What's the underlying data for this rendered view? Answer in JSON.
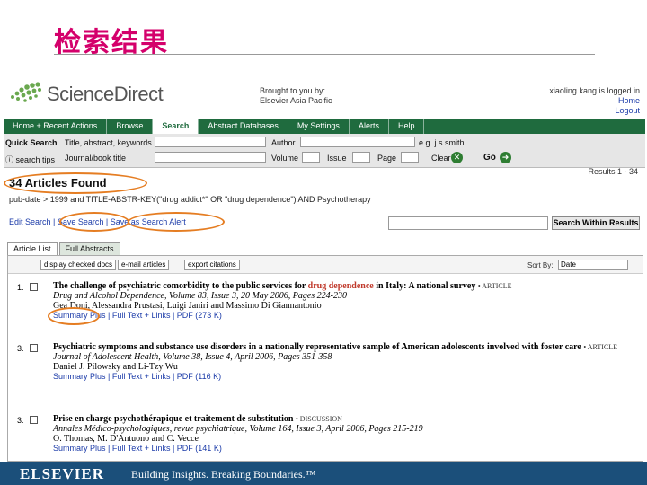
{
  "slide": {
    "title": "检索结果"
  },
  "header": {
    "logo_text": "ScienceDirect",
    "brought_to_you_by": "Brought to you by:",
    "institution": "Elsevier Asia Pacific",
    "user": "xiaoling kang is logged in",
    "home_link": "Home",
    "logout_link": "Logout"
  },
  "nav": {
    "items": [
      {
        "label": "Home + Recent Actions"
      },
      {
        "label": "Browse"
      },
      {
        "label": "Search"
      },
      {
        "label": "Abstract Databases"
      },
      {
        "label": "My Settings"
      },
      {
        "label": "Alerts"
      },
      {
        "label": "Help"
      }
    ]
  },
  "quick_search": {
    "label": "Quick Search",
    "field1_label": "Title, abstract, keywords",
    "author_label": "Author",
    "author_value": "e.g. j s smith",
    "search_tips": "search tips",
    "journal_label": "Journal/book title",
    "volume_label": "Volume",
    "issue_label": "Issue",
    "page_label": "Page",
    "clear_label": "Clear",
    "go_label": "Go"
  },
  "results": {
    "found_text": "34 Articles Found",
    "range_text": "Results 1 - 34",
    "query_text": "pub-date > 1999 and TITLE-ABSTR-KEY(\"drug addict*\" OR \"drug dependence\") AND Psychotherapy",
    "edit_search": "Edit Search",
    "save_search": "Save Search",
    "save_alert": "Save as Search Alert",
    "search_within_button": "Search Within Results",
    "tabs": [
      {
        "label": "Article List"
      },
      {
        "label": "Full Abstracts"
      }
    ],
    "toolbar": {
      "display_checked": "display checked docs",
      "email_articles": "e-mail articles",
      "export_citations": "export citations",
      "sort_label": "Sort By:",
      "sort_value": "Date"
    },
    "items": [
      {
        "num": "1.",
        "title_pre": "The challenge of psychiatric comorbidity to the public services for ",
        "title_hl": "drug dependence",
        "title_post": " in Italy: A national survey",
        "type": "• ARTICLE",
        "journal": "Drug and Alcohol Dependence, Volume 83, Issue 3, 20 May 2006, Pages 224-230",
        "authors": "Gea Doni, Alessandra Prustasi, Luigi Janiri and Massimo Di Giannantonio",
        "links": "Summary Plus | Full Text + Links | PDF (273 K)"
      },
      {
        "num": "3.",
        "title_pre": "Psychiatric symptoms and substance use disorders in a nationally representative sample of American adolescents involved with foster care",
        "title_hl": "",
        "title_post": "",
        "type": "• ARTICLE",
        "journal": "Journal of Adolescent Health, Volume 38, Issue 4, April 2006, Pages 351-358",
        "authors": "Daniel J. Pilowsky and Li-Tzy Wu",
        "links": "Summary Plus | Full Text + Links | PDF (116 K)"
      },
      {
        "num": "3.",
        "title_pre": "Prise en charge psychothérapique et traitement de substitution",
        "title_hl": "",
        "title_post": "",
        "type": "• DISCUSSION",
        "journal": "Annales Médico-psychologiques, revue psychiatrique, Volume 164, Issue 3, April 2006, Pages 215-219",
        "authors": "O. Thomas, M. D'Antuono and C. Vecce",
        "links": "Summary Plus | Full Text + Links | PDF (141 K)"
      }
    ]
  },
  "footer": {
    "brand": "ELSEVIER",
    "tagline": "Building Insights. Breaking Boundaries.™"
  },
  "colors": {
    "title": "#d4006b",
    "nav_green": "#1f6b3e",
    "highlight_ring": "#e57d22",
    "footer_blue": "#1b4f7a"
  }
}
